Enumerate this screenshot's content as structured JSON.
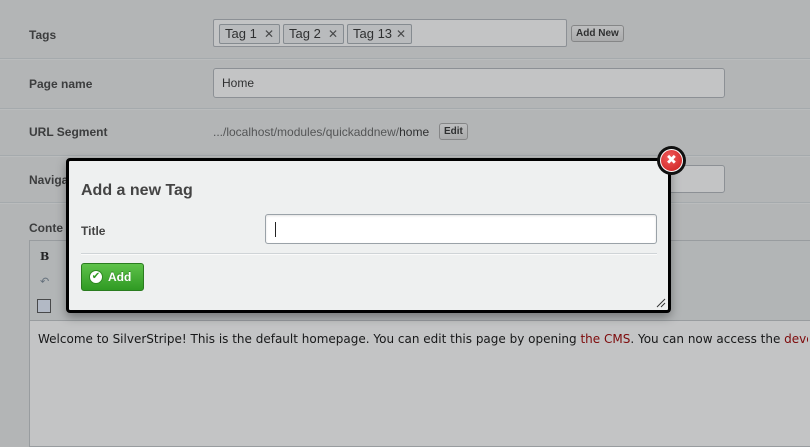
{
  "form": {
    "tags_label": "Tags",
    "tags": [
      {
        "label": "Tag 1",
        "remove": "✕"
      },
      {
        "label": "Tag 2",
        "remove": "✕"
      },
      {
        "label": "Tag 13",
        "remove": "✕"
      }
    ],
    "add_new_label": "Add New",
    "page_name_label": "Page name",
    "page_name_value": "Home",
    "url_segment_label": "URL Segment",
    "url_prefix": ".../localhost/modules/quickaddnew/",
    "url_segment_value": "home",
    "edit_label": "Edit",
    "navigation_label": "Naviga",
    "content_label": "Conte",
    "editor_text_1": "Welcome to SilverStripe! This is the default homepage. You can edit this page by opening ",
    "editor_link_1": "the CMS",
    "editor_text_2": ". You can now access the ",
    "editor_link_2": "develope"
  },
  "dialog": {
    "title": "Add a new Tag",
    "title_field_label": "Title",
    "title_field_value": "",
    "add_button_label": "Add",
    "close_icon": "✖"
  },
  "colors": {
    "add_button": "#3aa82d",
    "close_button": "#d92c2c",
    "link": "#a00000"
  }
}
